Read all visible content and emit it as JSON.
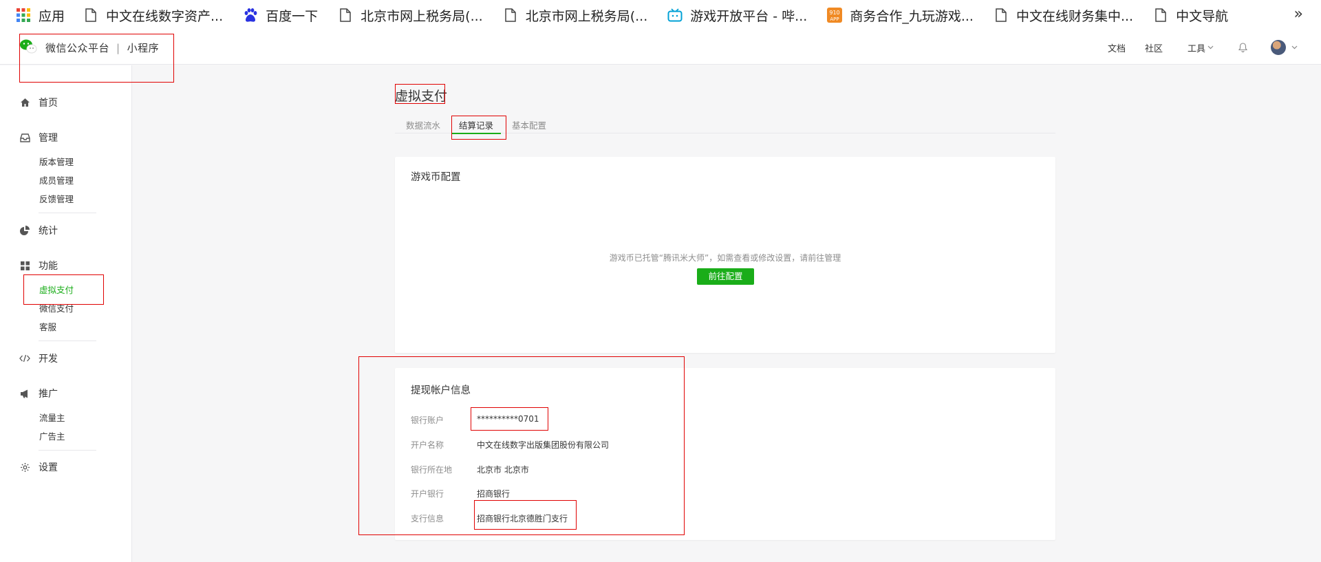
{
  "bookmarks": [
    {
      "label": "应用",
      "icon": "apps-grid-icon"
    },
    {
      "label": "中文在线数字资产...",
      "icon": "page-icon"
    },
    {
      "label": "百度一下",
      "icon": "baidu-paw-icon"
    },
    {
      "label": "北京市网上税务局(...",
      "icon": "page-icon"
    },
    {
      "label": "北京市网上税务局(...",
      "icon": "page-icon"
    },
    {
      "label": "游戏开放平台 - 哔...",
      "icon": "bilibili-tv-icon"
    },
    {
      "label": "商务合作_九玩游戏...",
      "icon": "app910-icon"
    },
    {
      "label": "中文在线财务集中...",
      "icon": "page-icon"
    },
    {
      "label": "中文导航",
      "icon": "page-icon"
    }
  ],
  "more_label": "»",
  "topbar": {
    "brand": "微信公众平台",
    "separator": "|",
    "product": "小程序",
    "docs": "文档",
    "community": "社区",
    "tools": "工具"
  },
  "sidebar": {
    "groups": [
      {
        "label": "首页",
        "icon": "home-icon",
        "items": []
      },
      {
        "label": "管理",
        "icon": "inbox-icon",
        "items": [
          "版本管理",
          "成员管理",
          "反馈管理"
        ]
      },
      {
        "label": "统计",
        "icon": "pie-chart-icon",
        "items": []
      },
      {
        "label": "功能",
        "icon": "grid-icon",
        "items": [
          "虚拟支付",
          "微信支付",
          "客服"
        ]
      },
      {
        "label": "开发",
        "icon": "code-icon",
        "items": []
      },
      {
        "label": "推广",
        "icon": "megaphone-icon",
        "items": [
          "流量主",
          "广告主"
        ]
      },
      {
        "label": "设置",
        "icon": "gear-icon",
        "items": []
      }
    ],
    "active_item": "虚拟支付"
  },
  "page": {
    "title": "虚拟支付",
    "tabs": [
      "数据流水",
      "结算记录",
      "基本配置"
    ],
    "active_tab": "结算记录"
  },
  "coin_card": {
    "title": "游戏币配置",
    "notice": "游戏币已托管“腾讯米大师”，如需查看或修改设置，请前往管理",
    "button": "前往配置"
  },
  "account_card": {
    "title": "提现帐户信息",
    "rows": [
      {
        "label": "银行账户",
        "value": "**********0701"
      },
      {
        "label": "开户名称",
        "value": "中文在线数字出版集团股份有限公司"
      },
      {
        "label": "银行所在地",
        "value": "北京市 北京市"
      },
      {
        "label": "开户银行",
        "value": "招商银行"
      },
      {
        "label": "支行信息",
        "value": "招商银行北京德胜门支行"
      }
    ]
  },
  "colors": {
    "accent": "#1aad19",
    "annotation": "#e00000"
  }
}
